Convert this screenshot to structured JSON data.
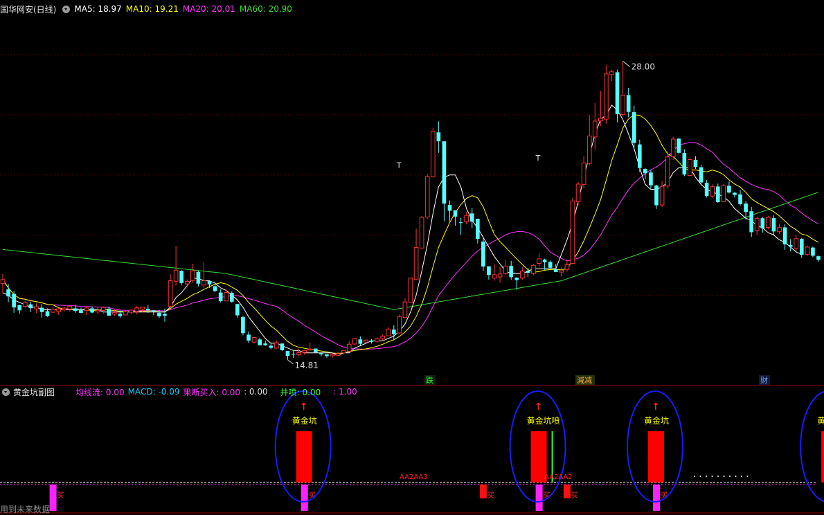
{
  "header": {
    "stock_name": "国华网安(日线)",
    "ma5": "MA5: 18.97",
    "ma10": "MA10: 19.21",
    "ma20": "MA20: 20.01",
    "ma60": "MA60: 20.90",
    "colors": {
      "stock": "#e0e0e0",
      "ma5": "#ffffff",
      "ma10": "#ffff00",
      "ma20": "#ff33ff",
      "ma60": "#33dd33"
    }
  },
  "price_labels": {
    "high": "28.00",
    "low": "14.81",
    "t_marker": "T",
    "dash_marker": "-"
  },
  "signal_tags": {
    "tag1": "跌",
    "tag2": "減减",
    "tag3": "财"
  },
  "sub_header": {
    "title": "黄金坑副图",
    "l1": "均线流: 0.00",
    "l2": "MACD: -0.09",
    "l3": "果断买入: 0.00",
    "l4": ": 0.00",
    "l5": "井喷: 0.00",
    "l6": ": 1.00",
    "colors": {
      "l1": "#ff33ff",
      "l2": "#00ccff",
      "l3": "#ff33ff",
      "l4": "#dddddd",
      "l5": "#33ff33",
      "l6": "#ff33ff"
    }
  },
  "signals": {
    "golden_pit": "黄金坑",
    "golden_pit_spray": "黄金坑喷",
    "aa1": "AA2AA3",
    "aa2": "AA2AA2",
    "buy_char": "买",
    "arrow": "↑"
  },
  "footer": {
    "note": "用到未来数据"
  },
  "chart_data": {
    "type": "candlestick",
    "ylim": [
      14.0,
      29.2
    ],
    "y_unit": "price",
    "candles": [
      [
        17.98,
        18.15,
        17.56,
        18.38
      ],
      [
        17.74,
        17.45,
        17.21,
        17.96
      ],
      [
        17.55,
        16.99,
        16.77,
        17.67
      ],
      [
        17.08,
        16.87,
        16.72,
        17.11
      ],
      [
        17.03,
        17.2,
        16.99,
        17.27
      ],
      [
        17.12,
        16.96,
        16.8,
        17.23
      ],
      [
        16.93,
        17.02,
        16.75,
        17.16
      ],
      [
        16.98,
        16.8,
        16.57,
        17.13
      ],
      [
        16.83,
        16.63,
        16.6,
        16.95
      ],
      [
        16.79,
        16.91,
        16.75,
        17.0
      ],
      [
        16.82,
        16.93,
        16.68,
        16.98
      ],
      [
        16.89,
        16.96,
        16.81,
        17.02
      ],
      [
        16.92,
        17.04,
        16.81,
        17.08
      ],
      [
        16.95,
        16.85,
        16.77,
        17.09
      ],
      [
        16.9,
        16.76,
        16.75,
        16.98
      ],
      [
        16.86,
        16.97,
        16.67,
        17.02
      ],
      [
        16.95,
        16.78,
        16.75,
        17.03
      ],
      [
        16.8,
        16.87,
        16.71,
        17.01
      ],
      [
        16.87,
        16.99,
        16.72,
        17.03
      ],
      [
        16.94,
        16.65,
        16.63,
        17.02
      ],
      [
        16.71,
        16.78,
        16.64,
        16.9
      ],
      [
        16.73,
        16.63,
        16.56,
        16.86
      ],
      [
        16.68,
        16.81,
        16.66,
        16.85
      ],
      [
        16.79,
        16.88,
        16.71,
        16.9
      ],
      [
        16.82,
        16.97,
        16.7,
        17.06
      ],
      [
        16.92,
        17.0,
        16.79,
        17.0
      ],
      [
        16.93,
        16.87,
        16.76,
        17.08
      ],
      [
        16.87,
        16.82,
        16.68,
        16.87
      ],
      [
        16.77,
        16.62,
        16.54,
        16.89
      ],
      [
        16.72,
        16.65,
        16.4,
        16.94
      ],
      [
        17.03,
        18.1,
        17.03,
        18.37
      ],
      [
        18.08,
        18.54,
        17.91,
        19.55
      ],
      [
        18.51,
        18.0,
        17.91,
        18.54
      ],
      [
        17.97,
        18.07,
        17.83,
        18.16
      ],
      [
        18.11,
        18.51,
        18.01,
        18.81
      ],
      [
        18.47,
        17.98,
        17.86,
        18.51
      ],
      [
        17.92,
        18.1,
        17.81,
        18.89
      ],
      [
        18.09,
        17.95,
        17.8,
        18.13
      ],
      [
        17.87,
        17.67,
        17.63,
        18.03
      ],
      [
        17.61,
        17.25,
        17.2,
        17.74
      ],
      [
        17.26,
        17.61,
        17.25,
        17.74
      ],
      [
        17.6,
        17.23,
        17.18,
        17.65
      ],
      [
        17.13,
        16.66,
        16.56,
        17.13
      ],
      [
        16.59,
        15.92,
        15.83,
        16.65
      ],
      [
        15.86,
        15.61,
        15.51,
        15.99
      ],
      [
        15.55,
        15.74,
        15.49,
        15.74
      ],
      [
        15.66,
        15.42,
        15.4,
        15.73
      ],
      [
        15.49,
        15.42,
        15.39,
        15.61
      ],
      [
        15.4,
        15.31,
        15.25,
        15.52
      ],
      [
        15.3,
        15.52,
        15.27,
        15.61
      ],
      [
        15.49,
        15.21,
        15.17,
        15.49
      ],
      [
        15.18,
        14.97,
        14.81,
        15.18
      ],
      [
        15.06,
        15.03,
        14.89,
        15.2
      ],
      [
        15.02,
        15.11,
        14.95,
        15.26
      ],
      [
        15.12,
        15.2,
        15.02,
        15.23
      ],
      [
        15.22,
        15.26,
        15.17,
        15.53
      ],
      [
        15.28,
        15.12,
        15.08,
        15.28
      ],
      [
        15.09,
        15.04,
        14.96,
        15.11
      ],
      [
        15.04,
        14.97,
        14.9,
        15.04
      ],
      [
        14.98,
        15.03,
        14.9,
        15.09
      ],
      [
        15.0,
        15.07,
        14.98,
        15.15
      ],
      [
        15.1,
        15.19,
        15.06,
        15.19
      ],
      [
        15.17,
        15.46,
        15.14,
        15.58
      ],
      [
        15.47,
        15.69,
        15.41,
        15.72
      ],
      [
        15.66,
        15.48,
        15.41,
        15.78
      ],
      [
        15.55,
        15.63,
        15.51,
        15.68
      ],
      [
        15.61,
        15.56,
        15.49,
        15.67
      ],
      [
        15.58,
        15.68,
        15.51,
        15.74
      ],
      [
        15.7,
        15.79,
        15.63,
        15.86
      ],
      [
        15.81,
        16.09,
        15.81,
        16.17
      ],
      [
        16.07,
        15.88,
        15.63,
        16.25
      ],
      [
        15.93,
        16.6,
        15.9,
        16.69
      ],
      [
        16.57,
        17.22,
        16.55,
        17.37
      ],
      [
        17.2,
        18.21,
        17.19,
        18.21
      ],
      [
        18.15,
        19.48,
        18.12,
        20.26
      ],
      [
        19.46,
        20.74,
        19.45,
        20.8
      ],
      [
        20.75,
        22.43,
        20.66,
        22.53
      ],
      [
        22.43,
        24.32,
        22.39,
        24.45
      ],
      [
        24.27,
        23.9,
        23.42,
        24.73
      ],
      [
        23.9,
        21.31,
        20.57,
        21.33
      ],
      [
        21.25,
        21.01,
        20.57,
        21.44
      ],
      [
        21.03,
        20.77,
        20.39,
        20.94
      ],
      [
        20.53,
        20.51,
        20.0,
        20.72
      ],
      [
        20.55,
        20.82,
        20.45,
        20.96
      ],
      [
        20.9,
        20.56,
        20.3,
        21.12
      ],
      [
        20.68,
        19.84,
        19.65,
        20.68
      ],
      [
        19.73,
        18.69,
        18.51,
        19.91
      ],
      [
        18.7,
        18.34,
        18.14,
        18.66
      ],
      [
        18.21,
        18.35,
        18.1,
        18.78
      ],
      [
        18.26,
        18.38,
        18.02,
        18.67
      ],
      [
        18.4,
        18.71,
        18.35,
        18.96
      ],
      [
        18.72,
        18.25,
        18.14,
        18.93
      ],
      [
        18.23,
        18.13,
        17.73,
        18.24
      ],
      [
        18.21,
        18.5,
        18.14,
        18.68
      ],
      [
        18.52,
        18.43,
        18.26,
        18.62
      ],
      [
        18.4,
        18.74,
        18.33,
        18.8
      ],
      [
        18.82,
        19.01,
        18.7,
        19.23
      ],
      [
        18.98,
        18.87,
        18.55,
        19.02
      ],
      [
        18.88,
        18.64,
        18.57,
        18.94
      ],
      [
        18.58,
        18.46,
        18.46,
        18.8
      ],
      [
        18.46,
        18.54,
        18.29,
        18.66
      ],
      [
        18.57,
        18.77,
        18.47,
        18.98
      ],
      [
        18.82,
        21.42,
        18.79,
        21.55
      ],
      [
        21.39,
        22.12,
        21.24,
        22.21
      ],
      [
        22.1,
        23.0,
        21.94,
        23.27
      ],
      [
        22.98,
        24.12,
        22.9,
        24.99
      ],
      [
        24.08,
        24.74,
        23.55,
        25.49
      ],
      [
        24.75,
        24.85,
        24.53,
        26.0
      ],
      [
        24.82,
        26.7,
        24.63,
        27.08
      ],
      [
        26.67,
        26.79,
        26.4,
        26.88
      ],
      [
        26.77,
        25.03,
        24.69,
        26.88
      ],
      [
        25.01,
        25.82,
        24.95,
        27.23
      ],
      [
        25.82,
        25.12,
        24.9,
        26.12
      ],
      [
        25.11,
        23.83,
        23.63,
        25.38
      ],
      [
        23.77,
        22.79,
        22.63,
        23.97
      ],
      [
        22.75,
        22.57,
        22.33,
        22.79
      ],
      [
        22.6,
        22.07,
        21.93,
        22.73
      ],
      [
        22.06,
        21.24,
        21.09,
        22.09
      ],
      [
        21.25,
        22.03,
        21.17,
        22.25
      ],
      [
        22.04,
        23.25,
        21.96,
        23.48
      ],
      [
        23.26,
        23.99,
        23.13,
        24.09
      ],
      [
        24.01,
        23.42,
        23.38,
        24.04
      ],
      [
        23.41,
        22.52,
        22.45,
        23.57
      ],
      [
        22.48,
        23.14,
        22.44,
        23.19
      ],
      [
        23.13,
        22.84,
        22.75,
        23.28
      ],
      [
        22.82,
        22.19,
        22.14,
        22.93
      ],
      [
        22.17,
        21.63,
        21.56,
        22.29
      ],
      [
        21.62,
        22.01,
        21.55,
        22.11
      ],
      [
        22.02,
        21.37,
        21.34,
        22.14
      ],
      [
        21.4,
        22.06,
        21.37,
        22.12
      ],
      [
        22.05,
        21.77,
        21.73,
        22.23
      ],
      [
        21.76,
        21.67,
        21.56,
        21.79
      ],
      [
        21.69,
        21.29,
        21.23,
        21.87
      ],
      [
        21.31,
        20.96,
        20.64,
        21.42
      ],
      [
        20.99,
        20.12,
        19.92,
        21.17
      ],
      [
        20.18,
        20.69,
        20.02,
        20.77
      ],
      [
        20.7,
        20.28,
        20.1,
        20.75
      ],
      [
        20.32,
        20.74,
        20.24,
        20.79
      ],
      [
        20.71,
        20.15,
        20.0,
        20.82
      ],
      [
        20.14,
        20.31,
        20.04,
        20.46
      ],
      [
        20.32,
        19.61,
        19.39,
        20.45
      ],
      [
        19.59,
        19.51,
        19.32,
        19.83
      ],
      [
        19.45,
        19.85,
        19.33,
        19.99
      ],
      [
        19.84,
        19.18,
        19.05,
        19.88
      ],
      [
        19.2,
        19.5,
        19.13,
        19.56
      ],
      [
        19.48,
        19.14,
        19.08,
        19.52
      ],
      [
        19.12,
        18.97,
        18.89,
        19.15
      ]
    ],
    "lines": {
      "ma5": [
        17.6,
        17.5,
        17.3,
        17.2,
        17.1,
        17.0,
        17.0,
        16.9,
        16.9,
        16.9,
        16.9,
        16.9,
        16.9,
        16.9,
        16.9,
        16.9,
        16.9,
        16.9,
        16.8,
        16.8,
        16.8,
        16.8,
        16.8,
        16.8,
        16.8,
        16.8,
        16.8,
        16.8,
        16.8,
        16.8,
        17.0,
        17.4,
        17.6,
        17.9,
        18.2,
        18.2,
        18.1,
        18.1,
        18.0,
        17.8,
        17.7,
        17.5,
        17.3,
        17.0,
        16.6,
        16.3,
        16.0,
        15.7,
        15.5,
        15.5,
        15.4,
        15.3,
        15.2,
        15.2,
        15.1,
        15.1,
        15.1,
        15.1,
        15.1,
        15.1,
        15.0,
        15.1,
        15.1,
        15.3,
        15.4,
        15.5,
        15.6,
        15.6,
        15.6,
        15.7,
        15.8,
        16.0,
        16.3,
        16.8,
        17.5,
        18.5,
        19.6,
        20.9,
        22.0,
        22.4,
        22.5,
        22.5,
        22.0,
        21.1,
        20.6,
        20.3,
        19.9,
        19.5,
        19.1,
        18.8,
        18.5,
        18.4,
        18.4,
        18.4,
        18.5,
        18.6,
        18.6,
        18.6,
        18.6,
        18.6,
        19.2,
        19.8,
        20.5,
        21.4,
        22.4,
        23.3,
        24.2,
        24.8,
        25.0,
        25.4,
        25.2,
        24.8,
        24.2,
        23.6,
        22.8,
        22.1,
        21.9,
        21.9,
        22.0,
        22.2,
        22.6,
        22.8,
        22.8,
        22.8,
        22.4,
        22.1,
        21.9,
        21.8,
        21.7,
        21.6,
        21.4,
        21.1,
        20.9,
        20.7,
        20.6,
        20.4,
        20.3,
        20.1,
        20.0,
        19.8,
        19.7,
        19.5,
        19.3,
        19.2
      ]
    },
    "x_labels": [],
    "sub": {
      "golden_pit_bars": [
        54,
        96,
        117,
        148
      ],
      "buy_bars": [
        9,
        54,
        86,
        96,
        101,
        117,
        148
      ]
    }
  }
}
